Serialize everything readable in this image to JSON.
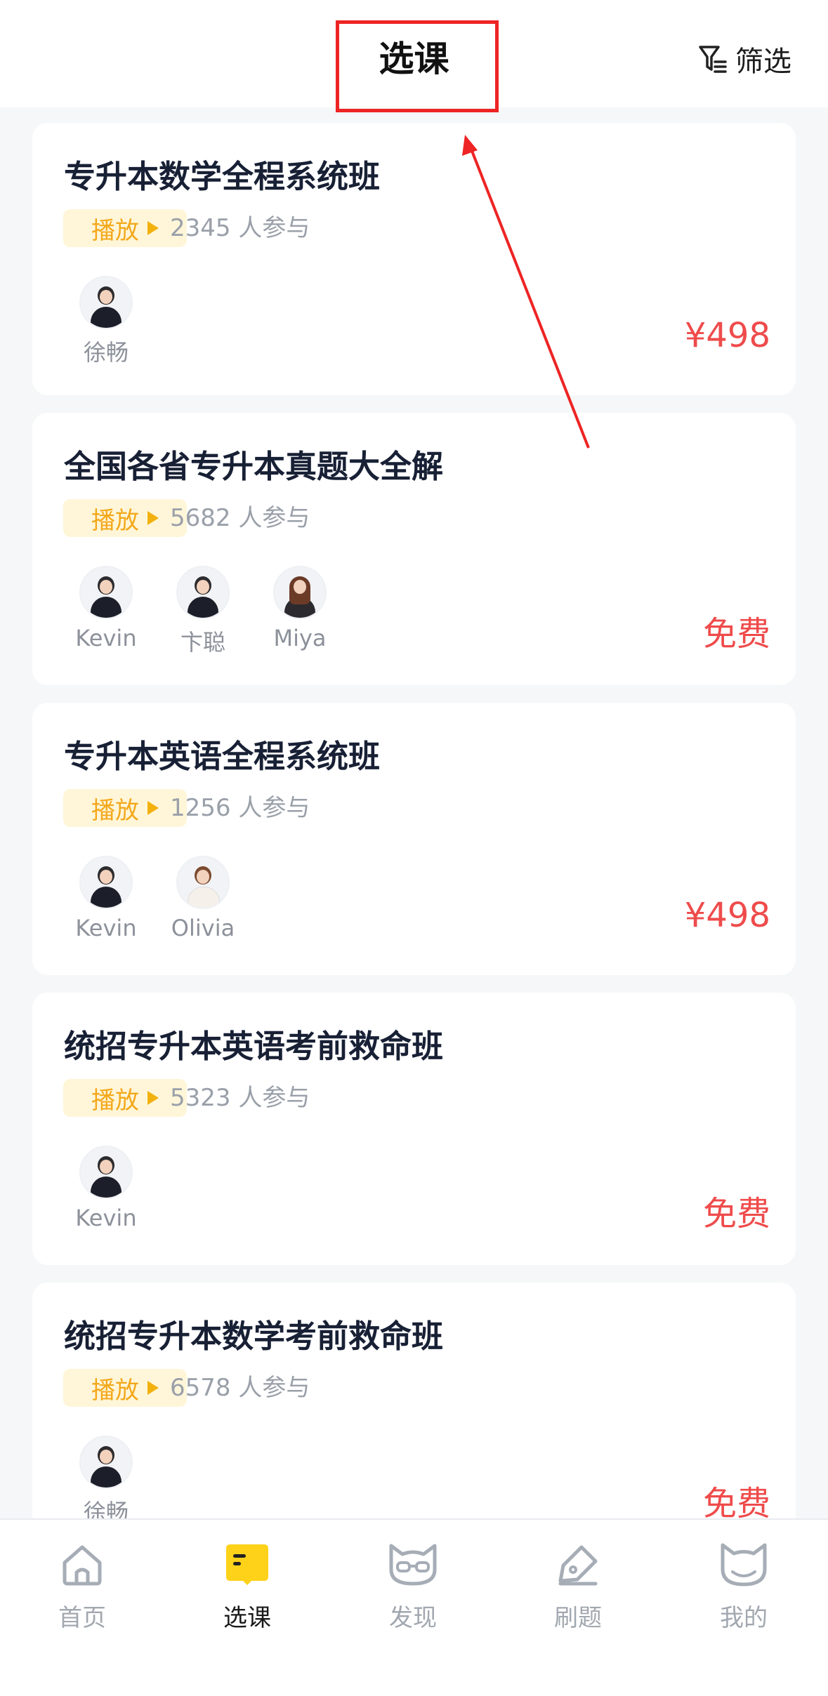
{
  "header": {
    "title": "选课",
    "filter_label": "筛选"
  },
  "courses": [
    {
      "title": "专升本数学全程系统班",
      "play_label": "播放",
      "participants": "2345 人参与",
      "teachers": [
        {
          "name": "徐畅"
        }
      ],
      "price": "¥498"
    },
    {
      "title": "全国各省专升本真题大全解",
      "play_label": "播放",
      "participants": "5682 人参与",
      "teachers": [
        {
          "name": "Kevin"
        },
        {
          "name": "卞聪"
        },
        {
          "name": "Miya"
        }
      ],
      "price": "免费"
    },
    {
      "title": "专升本英语全程系统班",
      "play_label": "播放",
      "participants": "1256 人参与",
      "teachers": [
        {
          "name": "Kevin"
        },
        {
          "name": "Olivia"
        }
      ],
      "price": "¥498"
    },
    {
      "title": "统招专升本英语考前救命班",
      "play_label": "播放",
      "participants": "5323 人参与",
      "teachers": [
        {
          "name": "Kevin"
        }
      ],
      "price": "免费"
    },
    {
      "title": "统招专升本数学考前救命班",
      "play_label": "播放",
      "participants": "6578 人参与",
      "teachers": [
        {
          "name": "徐畅"
        }
      ],
      "price": "免费"
    }
  ],
  "tabbar": {
    "items": [
      {
        "label": "首页",
        "icon": "home-icon"
      },
      {
        "label": "选课",
        "icon": "course-book-icon",
        "active": true
      },
      {
        "label": "发现",
        "icon": "discover-cat-icon"
      },
      {
        "label": "刷题",
        "icon": "pen-practice-icon"
      },
      {
        "label": "我的",
        "icon": "profile-cat-icon"
      }
    ]
  },
  "colors": {
    "accent_yellow": "#f3b10f",
    "price_red": "#ef4b4b",
    "annotation_red": "#ee2424"
  }
}
